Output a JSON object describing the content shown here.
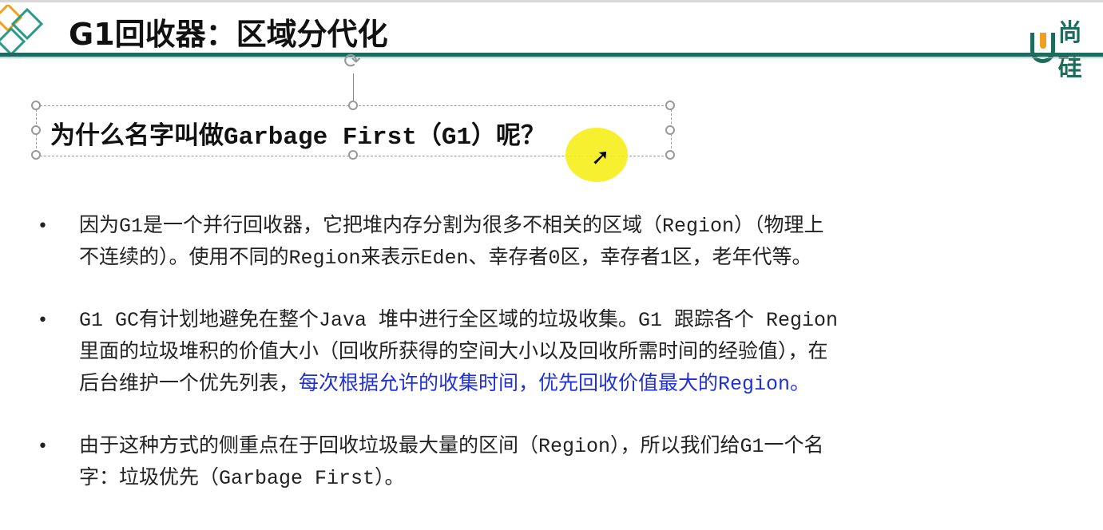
{
  "slide": {
    "title": "G1回收器：区域分代化",
    "brand": "尚硅",
    "subtitle": "为什么名字叫做Garbage First（G1）呢？",
    "bullets": [
      {
        "lines": [
          [
            {
              "text": "因为G1是一个并行回收器，它把堆内存分割为很多不相关的区域（Region）（物理上"
            }
          ],
          [
            {
              "text": "不连续的）。使用不同的Region来表示Eden、幸存者0区，幸存者1区，老年代等。"
            }
          ]
        ]
      },
      {
        "lines": [
          [
            {
              "text": "G1 GC有计划地避免在整个Java 堆中进行全区域的垃圾收集。G1 跟踪各个 Region"
            }
          ],
          [
            {
              "text": "里面的垃圾堆积的价值大小（回收所获得的空间大小以及回收所需时间的经验值），在"
            }
          ],
          [
            {
              "text": "后台维护一个优先列表，"
            },
            {
              "text": "每次根据允许的收集时间，优先回收价值最大的Region。",
              "color": "#2030d8"
            }
          ]
        ]
      },
      {
        "lines": [
          [
            {
              "text": "由于这种方式的侧重点在于回收垃圾最大量的区间（Region），所以我们给G1一个名"
            }
          ],
          [
            {
              "text": "字：垃圾优先（Garbage First）。"
            }
          ]
        ]
      }
    ]
  },
  "colors": {
    "accent": "#1e6b5e",
    "highlight_text": "#2030d8",
    "cursor_highlight": "#f5ee1a"
  }
}
